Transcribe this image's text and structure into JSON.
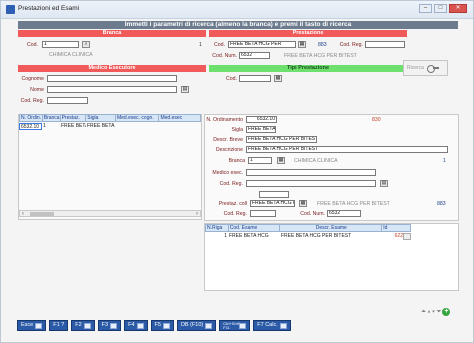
{
  "window": {
    "title": "Prestazioni ed Esami",
    "buttons": [
      "–",
      "□",
      "✕"
    ]
  },
  "banner": "Immetti i parametri di ricerca (almeno la branca) e premi il tasto di ricerca",
  "branca": {
    "title": "Branca",
    "cod_label": "Cod.",
    "cod_value": "1",
    "right_num": "1",
    "desc": "CHIMICA CLINICA"
  },
  "prestazione": {
    "title": "Prestazione",
    "cod_label": "Cod.",
    "cod_value": "FREE BETA HCG PER",
    "num_value": "883",
    "cod_reg_label": "Cod. Reg.",
    "cod_reg_value": "",
    "cod_num_label": "Cod. Num.",
    "cod_num_value": "6532",
    "desc": "FREE BETA HCG PER BITEST"
  },
  "medico": {
    "title": "Medico Esecutore",
    "cognome_label": "Cognome",
    "nome_label": "Nome",
    "cod_reg_label": "Cod. Reg."
  },
  "tipi": {
    "title": "Tipi Prestazione",
    "cod_label": "Cod."
  },
  "cerca_label": "Ricerca",
  "left_grid": {
    "headers": [
      "N. Ordin.",
      "Branca",
      "Prestaz.",
      "Sigla",
      "Med.esec. cogn.",
      "Med.esec"
    ],
    "rows": [
      [
        "6532.10",
        "1",
        "FREE BETA H",
        "FREE BETA",
        "",
        ""
      ]
    ]
  },
  "detail": {
    "n_ord_label": "N. Ordinamento",
    "n_ord_value": "6532.10",
    "n_ord_right": "830",
    "sigla_label": "Sigla",
    "sigla_value": "FREE BETA",
    "descr_breve_label": "Descr. Breve",
    "descr_breve_value": "FREE BETA HCG PER BITEST",
    "descrizione_label": "Descrizione",
    "descrizione_value": "FREE BETA HCG PER BITEST",
    "branca_label": "Branca",
    "branca_value": "1",
    "branca_desc": "CHIMICA CLINICA",
    "branca_num": "1",
    "medico_label": "Medico esec.",
    "cod_reg_label": "Cod. Reg.",
    "prestaz_coll_label": "Prestaz. coll",
    "prestaz_coll_value": "FREE BETA HCG PER",
    "prestaz_coll_desc": "FREE BETA HCG PER BITEST",
    "prestaz_coll_num": "883",
    "cod_reg2_label": "Cod. Reg.",
    "cod_num_label": "Cod. Num.",
    "cod_num_value": "6532"
  },
  "exam_grid": {
    "headers": [
      "N.Riga",
      "Cod. Esame",
      "Descr. Esame",
      "Id"
    ],
    "rows": [
      [
        "1",
        "FREE BETA HCG",
        "FREE BETA HCG PER BITEST",
        "622"
      ]
    ]
  },
  "toolbar": {
    "buttons": [
      {
        "label": "Esce",
        "key": "esc"
      },
      {
        "label": "F1 ?",
        "key": "f1"
      },
      {
        "label": "F2",
        "key": "f2"
      },
      {
        "label": "F3",
        "key": "f3"
      },
      {
        "label": "F4",
        "key": "f4"
      },
      {
        "label": "F5",
        "key": "f5"
      },
      {
        "label": "DB (F10)",
        "key": "f10"
      },
      {
        "label": "Ctrl+Shift F11",
        "key": "f11"
      },
      {
        "label": "F7 Calc.",
        "key": "f7"
      }
    ]
  },
  "nav": {
    "arrows": "⏶ ▴ ▾ ⏷",
    "add": "+"
  }
}
